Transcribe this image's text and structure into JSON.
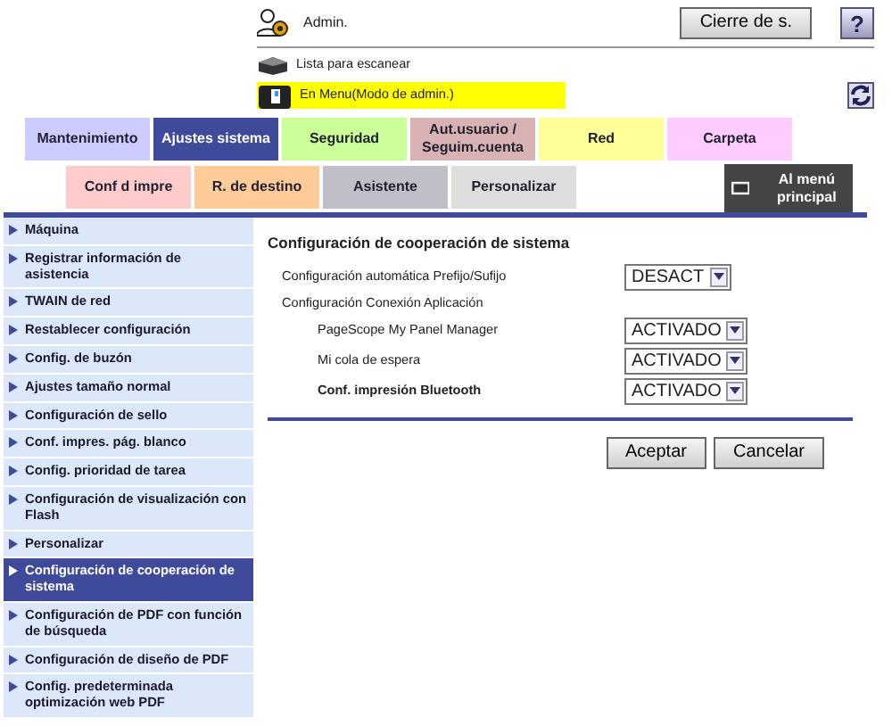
{
  "header": {
    "user": "Admin.",
    "logout_button": "Cierre de s.",
    "help_button": "?",
    "status": "Lista para escanear",
    "mode": "En Menu(Modo de admin.)"
  },
  "tabs_row_1": [
    {
      "label": "Mantenimiento",
      "selected": false,
      "color": "#ccccff"
    },
    {
      "label": "Ajustes sistema",
      "selected": true,
      "color": "#3f4a9a"
    },
    {
      "label": "Seguridad",
      "selected": false,
      "color": "#ccff99"
    },
    {
      "label": "Aut.usuario / Seguim.cuenta",
      "selected": false,
      "color": "#d9b3b3"
    },
    {
      "label": "Red",
      "selected": false,
      "color": "#ffff99"
    },
    {
      "label": "Carpeta",
      "selected": false,
      "color": "#ffccff"
    }
  ],
  "tabs_row_2": [
    {
      "label": "Conf d impre",
      "selected": false,
      "color": "#ffcccc"
    },
    {
      "label": "R. de destino",
      "selected": false,
      "color": "#ffcc99"
    },
    {
      "label": "Asistente",
      "selected": false,
      "color": "#c0bfc8"
    },
    {
      "label": "Personalizar",
      "selected": false,
      "color": "#dddddd"
    }
  ],
  "main_menu_button": "Al menú principal",
  "sidebar": {
    "items": [
      {
        "label": "Máquina",
        "selected": false
      },
      {
        "label": "Registrar información de asistencia",
        "selected": false
      },
      {
        "label": "TWAIN de red",
        "selected": false
      },
      {
        "label": "Restablecer configuración",
        "selected": false
      },
      {
        "label": "Config. de buzón",
        "selected": false
      },
      {
        "label": "Ajustes tamaño normal",
        "selected": false
      },
      {
        "label": "Configuración de sello",
        "selected": false
      },
      {
        "label": "Conf. impres. pág. blanco",
        "selected": false
      },
      {
        "label": "Config. prioridad de tarea",
        "selected": false
      },
      {
        "label": "Configuración de visualización con Flash",
        "selected": false
      },
      {
        "label": "Personalizar",
        "selected": false
      },
      {
        "label": "Configuración de cooperación de sistema",
        "selected": true
      },
      {
        "label": "Configuración de PDF con función de búsqueda",
        "selected": false
      },
      {
        "label": "Configuración de diseño de PDF",
        "selected": false
      },
      {
        "label": "Config. predeterminada optimización web PDF",
        "selected": false
      }
    ]
  },
  "content": {
    "title": "Configuración de cooperación de sistema",
    "settings": [
      {
        "label": "Configuración automática Prefijo/Sufijo",
        "value": "DESACT",
        "emphasis": false
      },
      {
        "label": "Configuración Conexión Aplicación",
        "emphasis": false,
        "children": [
          {
            "label": "PageScope My Panel Manager",
            "value": "ACTIVADO",
            "emphasis": false
          },
          {
            "label": "Mi cola de espera",
            "value": "ACTIVADO",
            "emphasis": false
          },
          {
            "label": "Conf. impresión Bluetooth",
            "value": "ACTIVADO",
            "emphasis": true
          }
        ]
      }
    ],
    "buttons": [
      "Aceptar",
      "Cancelar"
    ]
  }
}
